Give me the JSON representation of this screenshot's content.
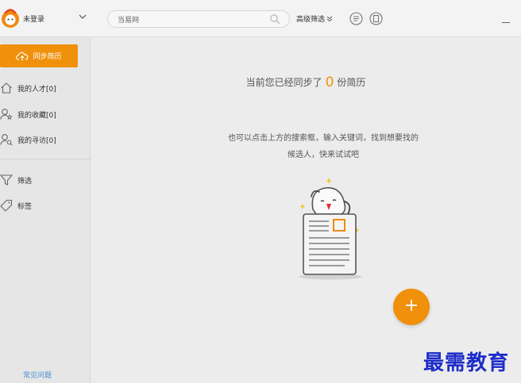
{
  "header": {
    "username": "未登录",
    "search_value": "当易网",
    "advanced_filter_label": "高级筛选"
  },
  "sidebar": {
    "sync_button_label": "同步简历",
    "items": [
      {
        "label": "我的人才[0]",
        "icon": "home-icon"
      },
      {
        "label": "我的收藏[0]",
        "icon": "user-star-icon"
      },
      {
        "label": "我的寻访[0]",
        "icon": "user-search-icon"
      },
      {
        "label": "筛选",
        "icon": "funnel-icon"
      },
      {
        "label": "标签",
        "icon": "tag-icon"
      }
    ],
    "faq_label": "常见问题"
  },
  "main": {
    "sync_prefix": "当前您已经同步了",
    "sync_count": "0",
    "sync_suffix": "份简历",
    "hint_line1": "也可以点击上方的搜索框，输入关键词，找到想要找的",
    "hint_line2": "候选人，快来试试吧",
    "fab_label": "+"
  },
  "watermark": "最需教育",
  "colors": {
    "accent": "#f0900b",
    "link": "#4a8fcf",
    "watermark": "#1d2cc9"
  }
}
